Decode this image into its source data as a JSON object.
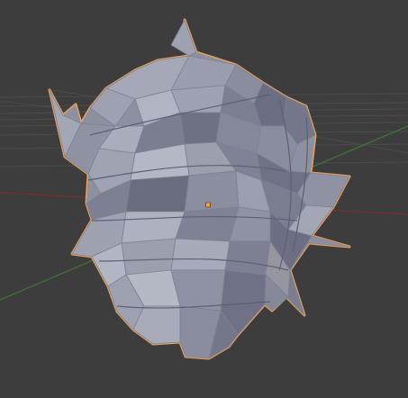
{
  "app": {
    "view": "3D Viewport"
  },
  "scene": {
    "object_name": "",
    "selected": true,
    "colors": {
      "background": "#3d3d3d",
      "grid_line": "#4a4a4a",
      "axis_x": "#7a2e2e",
      "axis_y": "#3f7a35",
      "outline_selected": "#e8a15a",
      "origin_point": "#ff9b30",
      "mesh_base": "#8d909f",
      "mesh_light": "#b1b4c2",
      "mesh_dark": "#63667a"
    },
    "icons": {
      "origin": "origin-point-icon"
    }
  }
}
